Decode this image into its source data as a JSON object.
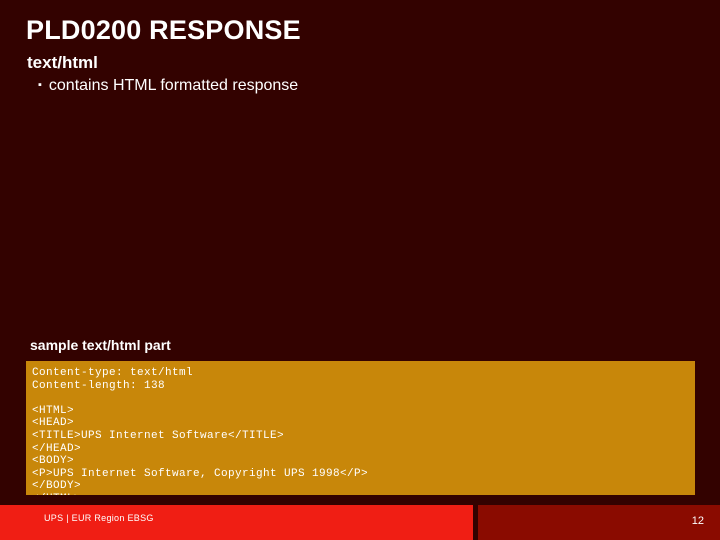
{
  "slide": {
    "title": "PLD0200 RESPONSE",
    "bullets": [
      {
        "level": 1,
        "text": "text/html"
      },
      {
        "level": 2,
        "marker": "▪",
        "text": "contains HTML formatted response"
      }
    ],
    "sample_caption": "sample text/html part",
    "code_block": {
      "background_color": "#c8870a",
      "text_color": "#ffffff",
      "lines": [
        "Content-type: text/html",
        "Content-length: 138",
        "",
        "<HTML>",
        "<HEAD>",
        "<TITLE>UPS Internet Software</TITLE>",
        "</HEAD>",
        "<BODY>",
        "<P>UPS Internet Software, Copyright UPS 1998</P>",
        "</BODY>",
        "</HTML>"
      ],
      "text": "Content-type: text/html\nContent-length: 138\n\n<HTML>\n<HEAD>\n<TITLE>UPS Internet Software</TITLE>\n</HEAD>\n<BODY>\n<P>UPS Internet Software, Copyright UPS 1998</P>\n</BODY>\n</HTML>"
    },
    "footer": {
      "text": "UPS | EUR Region EBSG",
      "page_number": "12",
      "left_bar_color": "#f01e14",
      "right_bar_color": "#8a0b00"
    },
    "background_color": "#330200",
    "text_color": "#ffffff"
  }
}
